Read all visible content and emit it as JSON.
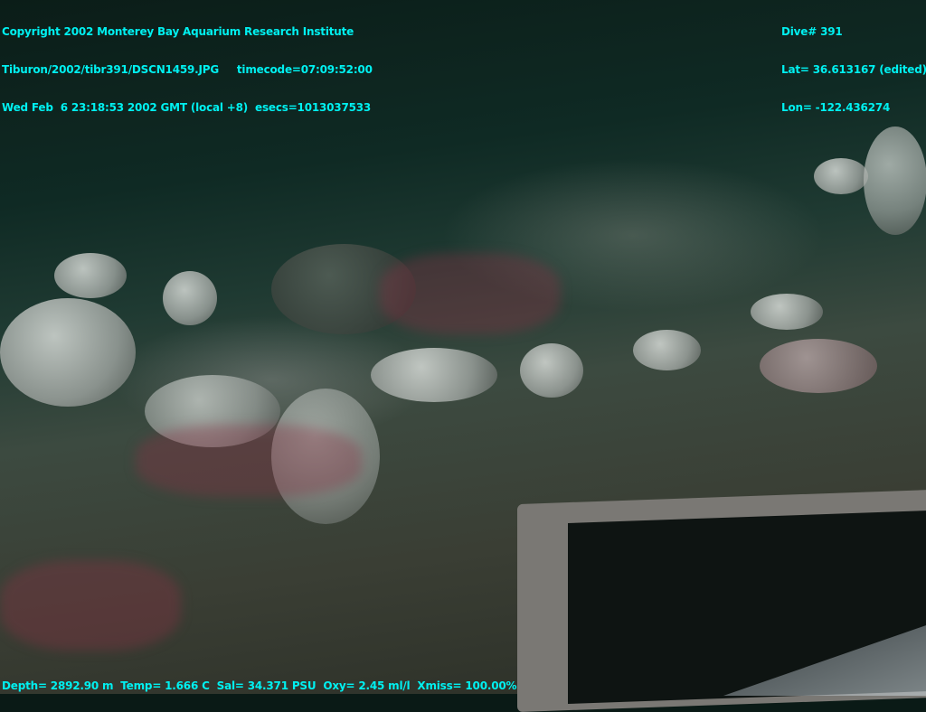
{
  "overlay_top_left": [
    "Copyright 2002 Monterey Bay Aquarium Research Institute",
    "Tiburon/2002/tibr391/DSCN1459.JPG     timecode=07:09:52:00",
    "Wed Feb  6 23:18:53 2002 GMT (local +8)  esecs=1013037533"
  ],
  "overlay_top_right": [
    "Dive# 391",
    "Lat= 36.613167 (edited)",
    "Lon= -122.436274"
  ],
  "overlay_bottom": "Depth= 2892.90 m  Temp= 1.666 C  Sal= 34.371 PSU  Oxy= 2.45 ml/l  Xmiss= 100.00%",
  "colors": {
    "overlay_text": "#00f0f0"
  }
}
